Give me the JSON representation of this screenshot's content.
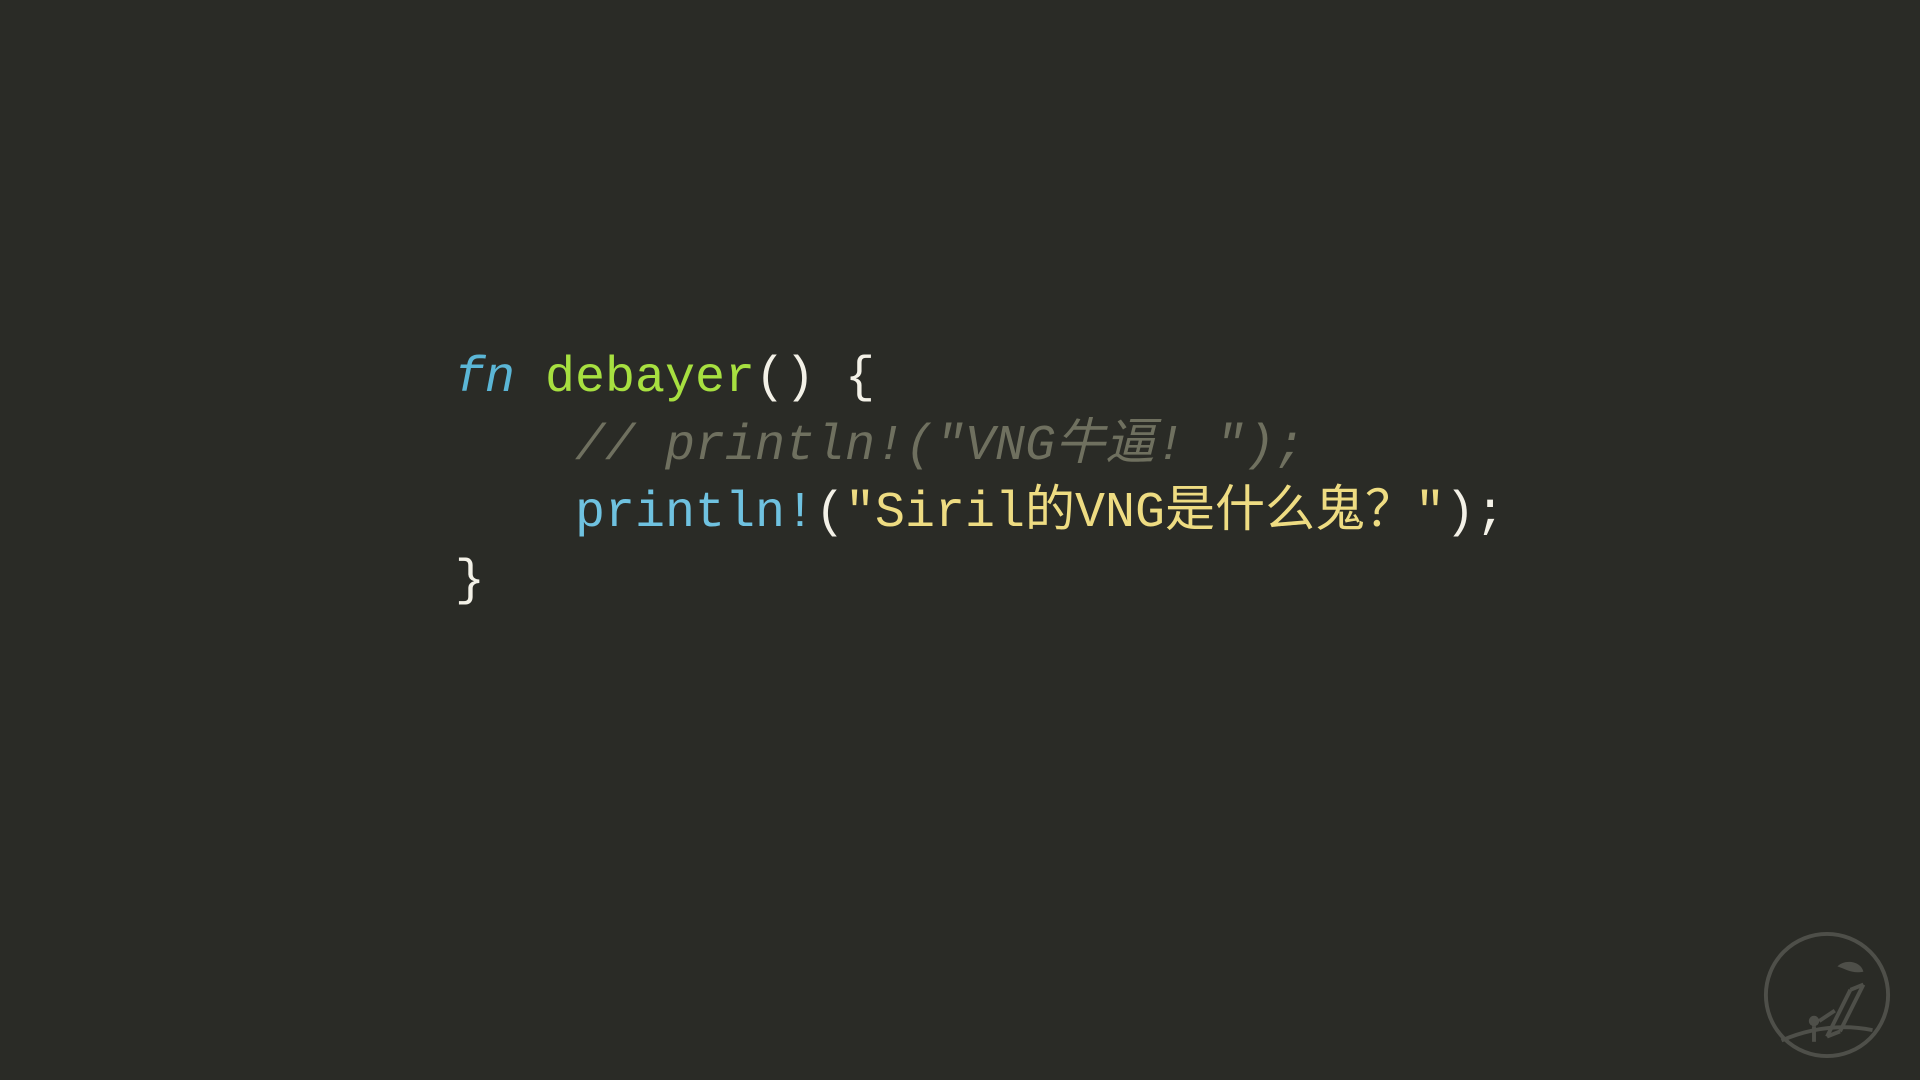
{
  "code": {
    "kw_fn": "fn",
    "fn_name": "debayer",
    "paren_open": "(",
    "paren_close": ")",
    "brace_open": "{",
    "brace_close": "}",
    "comment_line": "// println!(\"VNG牛逼! \");",
    "macro_name": "println!",
    "call_open": "(",
    "string_literal": "\"Siril的VNG是什么鬼？\"",
    "call_close": ")",
    "semicolon": ";"
  },
  "colors": {
    "background": "#2a2b26",
    "keyword": "#5bb6d6",
    "function": "#a7e040",
    "punct": "#f3f1e7",
    "comment": "#6f705f",
    "macro": "#6fc2e0",
    "string": "#eedc82"
  },
  "watermark": {
    "name": "astronomy-logo"
  }
}
